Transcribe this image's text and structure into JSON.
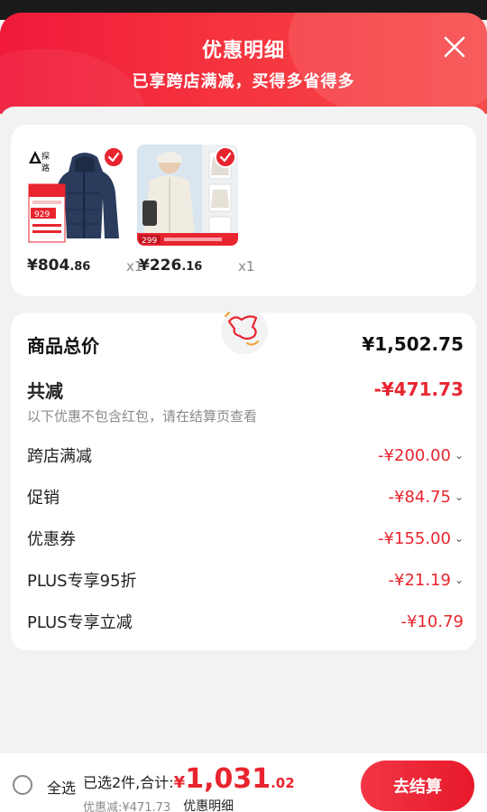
{
  "header": {
    "title": "优惠明细",
    "subtitle": "已享跨店满减，买得多省得多"
  },
  "products": [
    {
      "brand_mark": "探路",
      "price_int": "¥804",
      "price_dec": ".86",
      "qty": "x1",
      "tag_price": "929"
    },
    {
      "price_int": "¥226",
      "price_dec": ".16",
      "qty": "x1",
      "tag_price": "299"
    }
  ],
  "summary": {
    "total_label": "商品总价",
    "total_value": "¥1,502.75",
    "saved_label": "共减",
    "saved_value": "-¥471.73",
    "note": "以下优惠不包含红包，请在结算页查看",
    "items": [
      {
        "label": "跨店满减",
        "value": "-¥200.00"
      },
      {
        "label": "促销",
        "value": "-¥84.75"
      },
      {
        "label": "优惠券",
        "value": "-¥155.00"
      },
      {
        "label": "PLUS专享95折",
        "value": "-¥21.19"
      },
      {
        "label": "PLUS专享立减",
        "value": "-¥10.79"
      }
    ]
  },
  "footer": {
    "select_all": "全选",
    "selected_text": "已选2件,合计:",
    "currency": "¥",
    "total_int": "1,031",
    "total_dec": ".02",
    "saved_text": "优惠减:¥471.73",
    "detail_link": "优惠明细",
    "checkout": "去结算"
  },
  "colors": {
    "accent": "#e8252f",
    "header_start": "#f0193a",
    "header_end": "#f74a4a"
  },
  "icons": {
    "close": "close-icon",
    "check": "check-icon",
    "chevron": "chevron-down-icon",
    "mascot": "mascot-icon"
  }
}
